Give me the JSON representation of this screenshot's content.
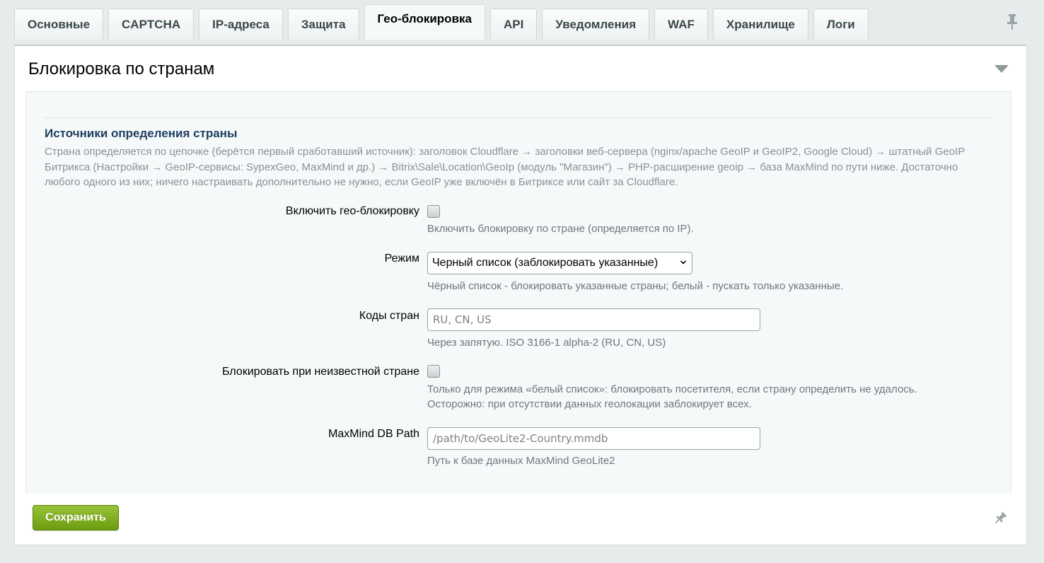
{
  "tabs": [
    {
      "label": "Основные"
    },
    {
      "label": "CAPTCHA"
    },
    {
      "label": "IP-адреса"
    },
    {
      "label": "Защита"
    },
    {
      "label": "Гео-блокировка"
    },
    {
      "label": "API"
    },
    {
      "label": "Уведомления"
    },
    {
      "label": "WAF"
    },
    {
      "label": "Хранилище"
    },
    {
      "label": "Логи"
    }
  ],
  "active_tab": "Гео-блокировка",
  "icons": {
    "pin_top": "pin-icon",
    "collapse": "collapse-arrow-icon",
    "select_chevron": "chevron-down-icon",
    "pin_bottom": "pin-icon"
  },
  "panel": {
    "title": "Блокировка по странам"
  },
  "section": {
    "heading": "Источники определения страны",
    "description": "Страна определяется по цепочке (берётся первый сработавший источник): заголовок Cloudflare → заголовки веб-сервера (nginx/apache GeoIP и GeoIP2, Google Cloud) → штатный GeoIP Битрикса (Настройки → GeoIP-сервисы: SypexGeo, MaxMind и др.) → Bitrix\\Sale\\Location\\GeoIp (модуль \"Магазин\") → PHP-расширение geoip → база MaxMind по пути ниже. Достаточно любого одного из них; ничего настраивать дополнительно не нужно, если GeoIP уже включён в Битриксе или сайт за Cloudflare."
  },
  "fields": {
    "enable": {
      "label": "Включить гео-блокировку",
      "checked": false,
      "hint": "Включить блокировку по стране (определяется по IP)."
    },
    "mode": {
      "label": "Режим",
      "selected": "Черный список (заблокировать указанные)",
      "hint": "Чёрный список - блокировать указанные страны; белый - пускать только указанные."
    },
    "countries": {
      "label": "Коды стран",
      "value": "",
      "placeholder": "RU, CN, US",
      "hint": "Через запятую. ISO 3166-1 alpha-2 (RU, CN, US)"
    },
    "block_unknown": {
      "label": "Блокировать при неизвестной стране",
      "checked": false,
      "hint_line1": "Только для режима «белый список»: блокировать посетителя, если страну определить не удалось.",
      "hint_line2": "Осторожно: при отсутствии данных геолокации заблокирует всех."
    },
    "maxmind": {
      "label": "MaxMind DB Path",
      "value": "",
      "placeholder": "/path/to/GeoLite2-Country.mmdb",
      "hint": "Путь к базе данных MaxMind GeoLite2"
    }
  },
  "footer": {
    "save_label": "Сохранить"
  },
  "colors": {
    "page_bg": "#e6ecec",
    "section_heading": "#1f3f5f",
    "save_button": "#7fad1f"
  }
}
